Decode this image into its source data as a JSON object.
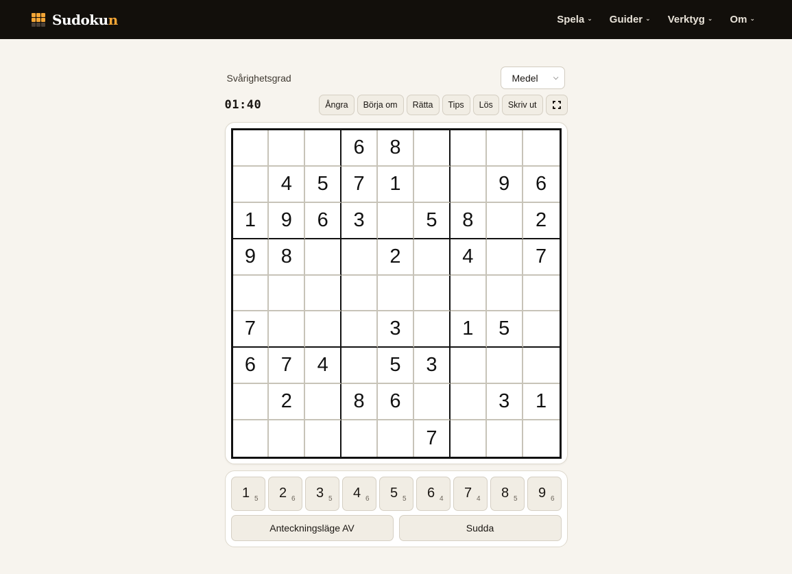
{
  "brand": {
    "name_main": "Sudoku",
    "name_accent": "n"
  },
  "nav": [
    {
      "label": "Spela"
    },
    {
      "label": "Guider"
    },
    {
      "label": "Verktyg"
    },
    {
      "label": "Om"
    }
  ],
  "difficulty": {
    "label": "Svårighetsgrad",
    "selected": "Medel"
  },
  "timer": "01:40",
  "toolbar": {
    "undo": "Ångra",
    "restart": "Börja om",
    "check": "Rätta",
    "hint": "Tips",
    "solve": "Lös",
    "print": "Skriv ut",
    "fullscreen_icon": "fullscreen-icon"
  },
  "grid": [
    [
      "",
      "",
      "",
      "6",
      "8",
      "",
      "",
      "",
      ""
    ],
    [
      "",
      "4",
      "5",
      "7",
      "1",
      "",
      "",
      "9",
      "6"
    ],
    [
      "1",
      "9",
      "6",
      "3",
      "",
      "5",
      "8",
      "",
      "2"
    ],
    [
      "9",
      "8",
      "",
      "",
      "2",
      "",
      "4",
      "",
      "7"
    ],
    [
      "",
      "",
      "",
      "",
      "",
      "",
      "",
      "",
      ""
    ],
    [
      "7",
      "",
      "",
      "",
      "3",
      "",
      "1",
      "5",
      ""
    ],
    [
      "6",
      "7",
      "4",
      "",
      "5",
      "3",
      "",
      "",
      ""
    ],
    [
      "",
      "2",
      "",
      "8",
      "6",
      "",
      "",
      "3",
      "1"
    ],
    [
      "",
      "",
      "",
      "",
      "",
      "7",
      "",
      "",
      ""
    ]
  ],
  "numpad": [
    {
      "digit": "1",
      "remaining": "5"
    },
    {
      "digit": "2",
      "remaining": "6"
    },
    {
      "digit": "3",
      "remaining": "5"
    },
    {
      "digit": "4",
      "remaining": "6"
    },
    {
      "digit": "5",
      "remaining": "5"
    },
    {
      "digit": "6",
      "remaining": "4"
    },
    {
      "digit": "7",
      "remaining": "4"
    },
    {
      "digit": "8",
      "remaining": "5"
    },
    {
      "digit": "9",
      "remaining": "6"
    }
  ],
  "actions": {
    "notes": "Anteckningsläge AV",
    "erase": "Sudda"
  },
  "colors": {
    "header_bg": "#120f0b",
    "accent": "#f2a536",
    "page_bg": "#f7f4ee"
  }
}
